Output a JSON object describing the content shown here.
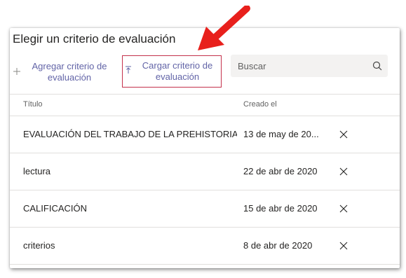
{
  "dialog": {
    "title": "Elegir un criterio de evaluación"
  },
  "toolbar": {
    "add_label": "Agregar criterio de evaluación",
    "add_icon": "plus-icon",
    "upload_label": "Cargar criterio de evaluación",
    "upload_icon": "upload-icon",
    "highlight_color": "#c4314b"
  },
  "search": {
    "placeholder": "Buscar",
    "icon": "search-icon"
  },
  "table": {
    "columns": [
      "Título",
      "Creado el"
    ],
    "rows": [
      {
        "title": "EVALUACIÓN DEL TRABAJO DE LA PREHISTORIA",
        "created": "13 de may de 20..."
      },
      {
        "title": "lectura",
        "created": "22 de abr de 2020"
      },
      {
        "title": "CALIFICACIÓN",
        "created": "15 de abr de 2020"
      },
      {
        "title": "criterios",
        "created": "8 de abr de 2020"
      }
    ]
  },
  "annotation": {
    "arrow_color": "#e8201c",
    "icon": "red-arrow-icon"
  },
  "colors": {
    "accent": "#6264a7",
    "text": "#252423",
    "muted": "#616161",
    "divider": "#e1dfdd"
  }
}
